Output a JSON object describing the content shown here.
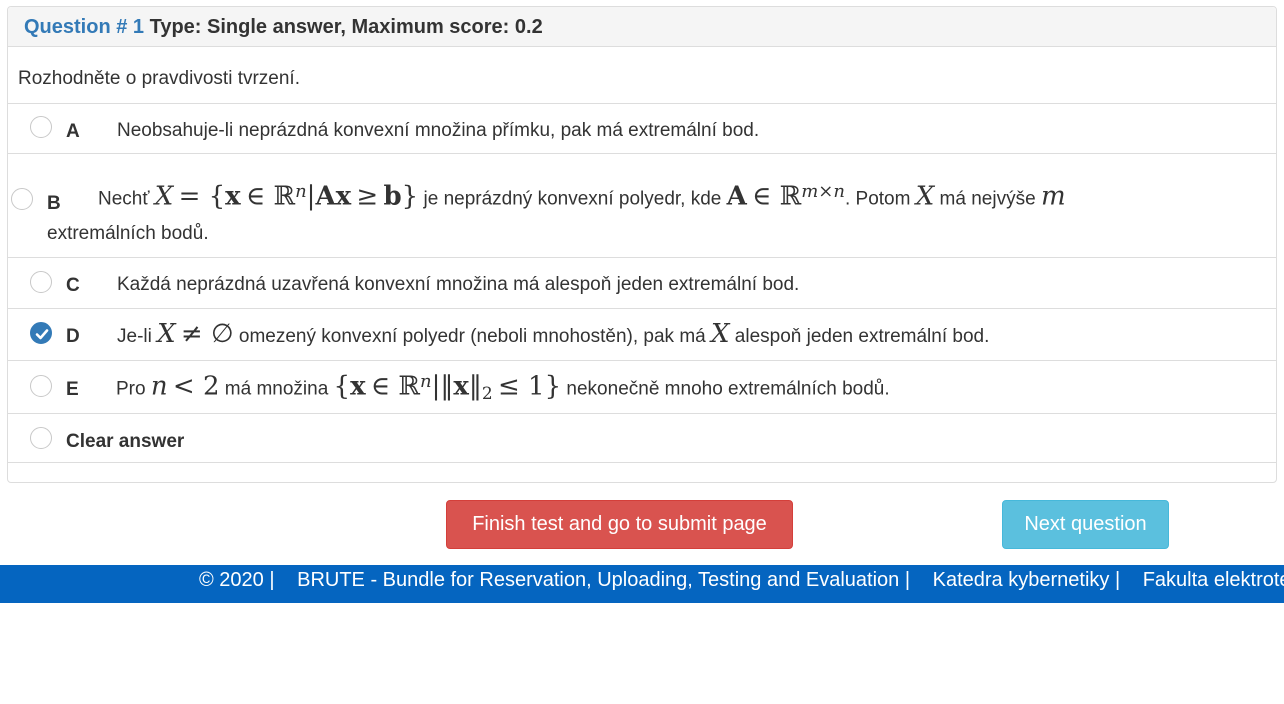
{
  "question": {
    "number_label": "Question # 1",
    "type_label": "Type: Single answer, Maximum score: 0.2",
    "prompt": "Rozhodněte o pravdivosti tvrzení."
  },
  "options": [
    {
      "letter": "A",
      "text": "Neobsahuje-li neprázdná konvexní množina přímku, pak má extremální bod.",
      "selected": false
    },
    {
      "letter": "B",
      "text_1": "Nechť",
      "text_2": "je neprázdný konvexní polyedr, kde",
      "text_3": ". Potom",
      "text_4": "má nejvýše",
      "text_5": "extremálních bodů.",
      "selected": false
    },
    {
      "letter": "C",
      "text": "Každá neprázdná uzavřená konvexní množina má alespoň jeden extremální bod.",
      "selected": false
    },
    {
      "letter": "D",
      "text_1": "Je-li",
      "text_2": "omezený konvexní polyedr (neboli mnohostěn), pak má",
      "text_3": "alespoň jeden extremální bod.",
      "selected": true
    },
    {
      "letter": "E",
      "text_1": "Pro",
      "text_2": "má množina",
      "text_3": "nekonečně mnoho extremálních bodů.",
      "selected": false
    }
  ],
  "clear_answer_label": "Clear answer",
  "buttons": {
    "finish_label": "Finish test and go to submit page",
    "next_label": "Next question"
  },
  "footer": {
    "copyright": "© 2020 |",
    "brute": "BRUTE - Bundle for Reservation, Uploading, Testing and Evaluation |",
    "katedra": "Katedra kybernetiky |",
    "fakulta": "Fakulta elektrotechnická"
  },
  "colors": {
    "accent": "#337ab7",
    "danger": "#d9534f",
    "info": "#5bc0de",
    "footer": "#0565c0"
  }
}
